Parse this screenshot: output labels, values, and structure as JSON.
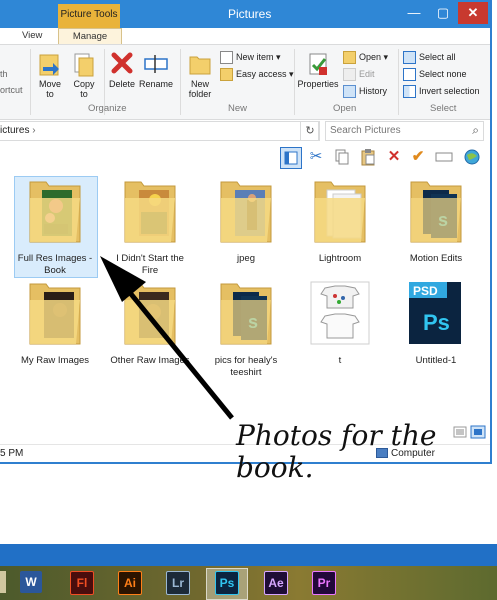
{
  "window": {
    "title": "Pictures",
    "context_tab": "Picture Tools",
    "tabs": [
      "View",
      "Manage"
    ],
    "controls": {
      "minimize": "—",
      "maximize": "▢",
      "close": "✕"
    }
  },
  "ribbon": {
    "left_cut": [
      "th",
      "ortcut"
    ],
    "organize": {
      "move_to": [
        "Move",
        "to"
      ],
      "copy_to": [
        "Copy",
        "to"
      ],
      "group_label": "Organize"
    },
    "delete": "Delete",
    "rename": "Rename",
    "new": {
      "new_folder": [
        "New",
        "folder"
      ],
      "new_item": "New item",
      "easy_access": "Easy access",
      "group_label": "New"
    },
    "open": {
      "properties": "Properties",
      "open": "Open",
      "edit": "Edit",
      "history": "History",
      "group_label": "Open"
    },
    "select": {
      "select_all": "Select all",
      "select_none": "Select none",
      "invert_selection": "Invert selection",
      "group_label": "Select"
    }
  },
  "address": {
    "path_text": "ictures",
    "separator": "›",
    "refresh": "↻",
    "search_placeholder": "Search Pictures"
  },
  "items": [
    {
      "label": "Full Res Images - Book",
      "type": "folder-photo",
      "selected": true
    },
    {
      "label": "I Didn't Start the Fire",
      "type": "folder-photo"
    },
    {
      "label": "jpeg",
      "type": "folder-photo"
    },
    {
      "label": "Lightroom",
      "type": "folder-blank"
    },
    {
      "label": "Motion Edits",
      "type": "folder-ps"
    },
    {
      "label": "My Raw Images",
      "type": "folder-photo"
    },
    {
      "label": "Other Raw Images",
      "type": "folder-photo"
    },
    {
      "label": "pics for healy's teeshirt",
      "type": "folder-ps"
    },
    {
      "label": "t",
      "type": "image-tshirt"
    },
    {
      "label": "Untitled-1",
      "type": "psd-file",
      "badge": "PSD",
      "badge2": "Ps"
    }
  ],
  "status": {
    "time": "5 PM",
    "location": "Computer"
  },
  "annotation": [
    "Photos for the",
    "book."
  ],
  "taskbar": {
    "apps": [
      {
        "name": "W",
        "color": "#2b579a"
      },
      {
        "name": "Fl",
        "color": "#f04e23"
      },
      {
        "name": "Ai",
        "color": "#ff7f18"
      },
      {
        "name": "Lr",
        "color": "#9ab7d3"
      },
      {
        "name": "Ps",
        "color": "#31c5f0"
      },
      {
        "name": "Ae",
        "color": "#d6a6ff"
      },
      {
        "name": "Pr",
        "color": "#ea77ff"
      }
    ]
  },
  "colors": {
    "titlebar": "#2f87d6",
    "context_tab": "#e9b33a",
    "close": "#c8392f",
    "taskbar_stripe": "#2170c6"
  }
}
